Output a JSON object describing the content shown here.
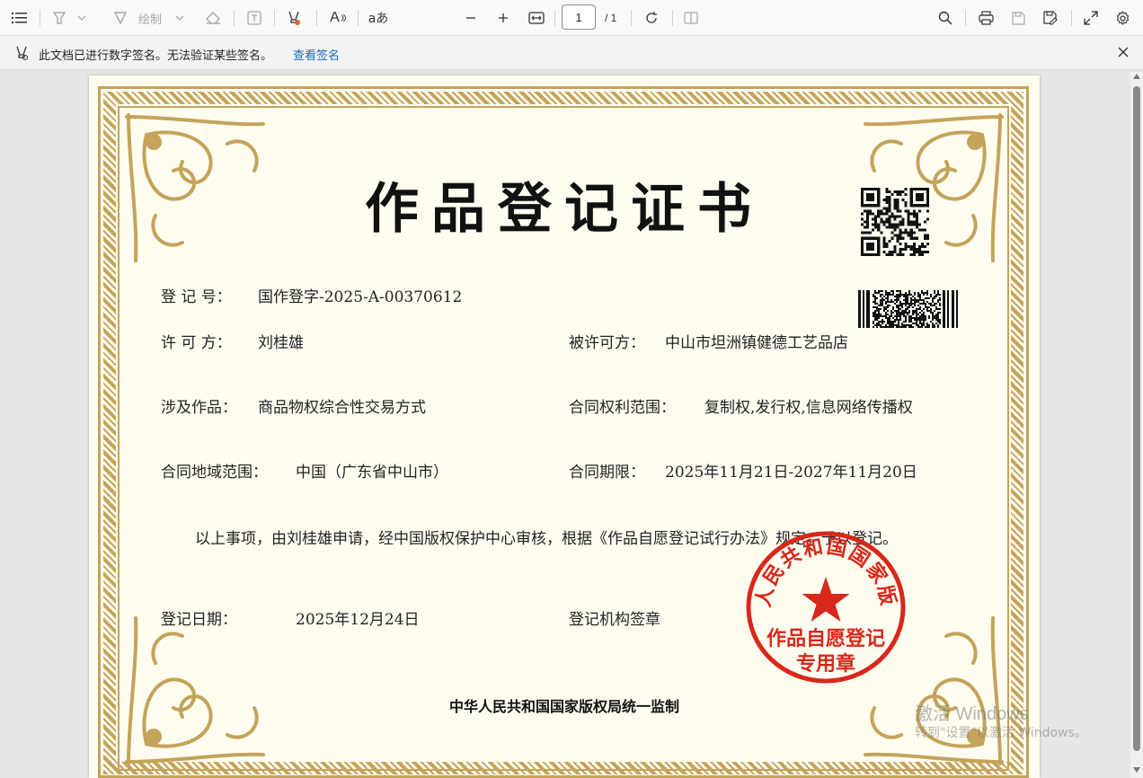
{
  "toolbar": {
    "draw_label": "绘制",
    "page_current": "1",
    "page_total": "/ 1",
    "read_aloud_glyph": "A",
    "translate_glyph": "aあ",
    "icons": [
      "contents-icon",
      "highlight-icon",
      "draw-icon",
      "eraser-icon",
      "text-box-icon",
      "signature-icon",
      "read-aloud-icon",
      "translate-icon",
      "zoom-out-icon",
      "zoom-in-icon",
      "fit-width-icon",
      "rotate-icon",
      "page-view-icon",
      "search-icon",
      "print-icon",
      "save-icon",
      "save-as-icon",
      "fullscreen-icon",
      "settings-icon"
    ]
  },
  "infobar": {
    "message": "此文档已进行数字签名。无法验证某些签名。",
    "link": "查看签名"
  },
  "certificate": {
    "title": "作品登记证书",
    "reg_no_label": "登 记 号：",
    "reg_no": "国作登字-2025-A-00370612",
    "licensor_label": "许 可 方：",
    "licensor": "刘桂雄",
    "licensee_label": "被许可方：",
    "licensee": "中山市坦洲镇健德工艺品店",
    "work_label": "涉及作品：",
    "work": "商品物权综合性交易方式",
    "scope_label": "合同权利范围：",
    "scope": "复制权,发行权,信息网络传播权",
    "region_label": "合同地域范围：",
    "region": "中国（广东省中山市）",
    "term_label": "合同期限：",
    "term": "2025年11月21日-2027年11月20日",
    "statement": "以上事项，由刘桂雄申请，经中国版权保护中心审核，根据《作品自愿登记试行办法》规定，予以登记。",
    "date_label": "登记日期：",
    "date": "2025年12月24日",
    "seal_label": "登记机构签章",
    "seal_outer_text": "中华人民共和国国家版权局",
    "seal_line1": "作品自愿登记",
    "seal_line2": "专用章",
    "footer": "中华人民共和国国家版权局统一监制"
  },
  "watermark": {
    "line1": "激活 Windows",
    "line2": "转到\"设置\"以激活 Windows。"
  },
  "colors": {
    "gold": "#c4a35a",
    "paper": "#fffdf0",
    "seal_red": "#d8281b",
    "link_blue": "#0f6cbd"
  }
}
